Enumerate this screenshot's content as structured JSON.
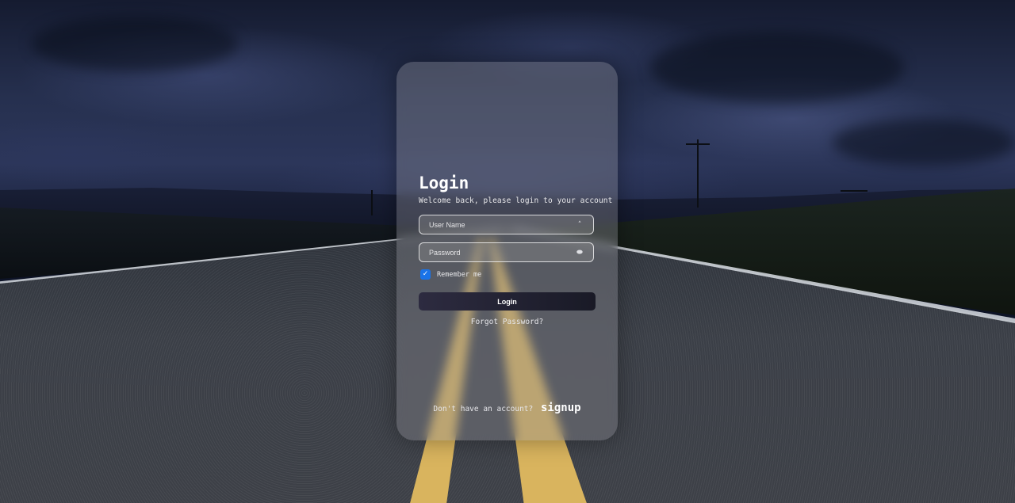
{
  "login": {
    "title": "Login",
    "subtitle": "Welcome back, please login to your account",
    "username": {
      "placeholder": "User Name",
      "value": "",
      "icon": "user-icon"
    },
    "password": {
      "placeholder": "Password",
      "value": "",
      "icon": "key-icon"
    },
    "remember": {
      "label": "Remember me",
      "checked": true
    },
    "submit_label": "Login",
    "forgot_label": "Forgot Password?",
    "signup_prompt": "Don't have an account?",
    "signup_label": "signup"
  },
  "colors": {
    "checkbox": "#1a73e8",
    "button": "#1f1e2e",
    "card": "rgba(140,140,146,0.38)"
  }
}
